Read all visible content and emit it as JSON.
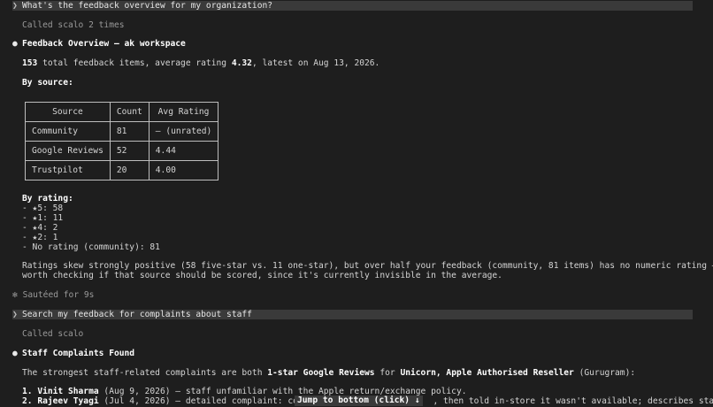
{
  "prompt1": {
    "chevron": "❯",
    "text": "What's the feedback overview for my organization?"
  },
  "called1": "Called scalo 2 times",
  "overview": {
    "bullet": "●",
    "title": "Feedback Overview — ak workspace",
    "summary_total": "153",
    "summary_mid1": " total feedback items, average rating ",
    "summary_avg": "4.32",
    "summary_end": ", latest on Aug 13, 2026.",
    "by_source_label": "By source:",
    "table": {
      "headers": [
        "Source",
        "Count",
        "Avg Rating"
      ],
      "rows": [
        [
          "Community",
          "81",
          "— (unrated)"
        ],
        [
          "Google Reviews",
          "52",
          "4.44"
        ],
        [
          "Trustpilot",
          "20",
          "4.00"
        ]
      ]
    },
    "by_rating_label": "By rating:",
    "ratings": [
      "- ★5: 58",
      "- ★1: 11",
      "- ★4: 2",
      "- ★2: 1",
      "- No rating (community): 81"
    ],
    "note_line1": "Ratings skew strongly positive (58 five-star vs. 11 one-star), but over half your feedback (community, 81 items) has no numeric rating —",
    "note_line2": "worth checking if that source should be scored, since it's currently invisible in the average."
  },
  "sauteed": {
    "icon": "✻",
    "text": "Sautéed for 9s"
  },
  "prompt2": {
    "chevron": "❯",
    "text": "Search my feedback for complaints about staff"
  },
  "called2": "Called scalo",
  "staff": {
    "bullet": "●",
    "title": "Staff Complaints Found",
    "intro_start": "The strongest staff-related complaints are both ",
    "intro_bold1": "1-star Google Reviews",
    "intro_mid": " for ",
    "intro_bold2": "Unicorn, Apple Authorised Reseller",
    "intro_end": " (Gurugram):",
    "items": [
      {
        "num": "1. ",
        "name": "Vinit Sharma",
        "text": " (Aug 9, 2026) — staff unfamiliar with the Apple return/exchange policy."
      },
      {
        "num": "2. ",
        "name": "Rajeev Tyagi",
        "text": " (Jul 4, 2026) — detailed complaint: conf",
        "text_after": ", then told in-store it wasn't available; describes staff"
      }
    ]
  },
  "jump_tooltip": "Jump to bottom (click) ↓"
}
